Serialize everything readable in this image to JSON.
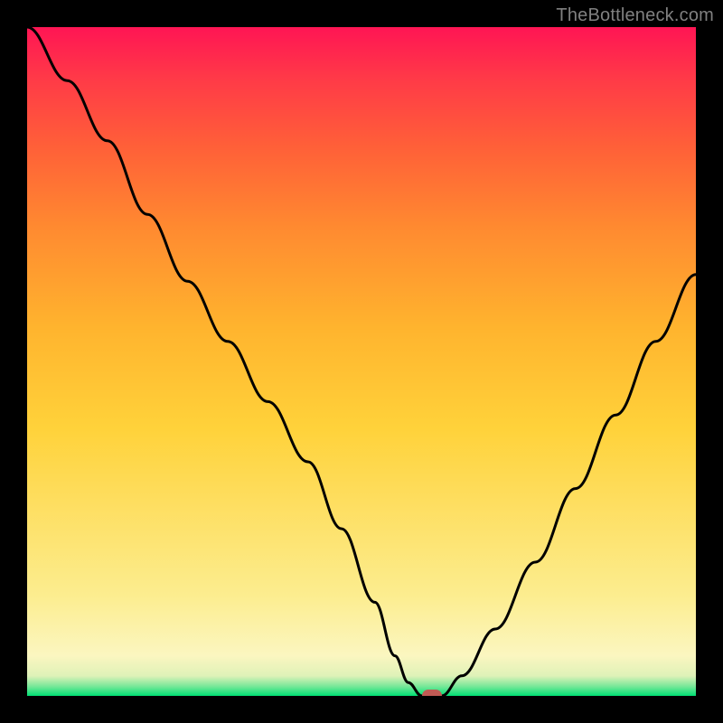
{
  "watermark": "TheBottleneck.com",
  "chart_data": {
    "type": "line",
    "title": "",
    "xlabel": "",
    "ylabel": "",
    "xlim": [
      0,
      100
    ],
    "ylim": [
      0,
      100
    ],
    "background_gradient_stops": [
      {
        "pos": 0.0,
        "color": "#00e074"
      },
      {
        "pos": 0.015,
        "color": "#7de89a"
      },
      {
        "pos": 0.03,
        "color": "#dff2b8"
      },
      {
        "pos": 0.06,
        "color": "#fbf6c0"
      },
      {
        "pos": 0.15,
        "color": "#fced8f"
      },
      {
        "pos": 0.4,
        "color": "#ffd23a"
      },
      {
        "pos": 0.55,
        "color": "#ffb42e"
      },
      {
        "pos": 0.7,
        "color": "#ff8a30"
      },
      {
        "pos": 0.82,
        "color": "#ff6038"
      },
      {
        "pos": 0.92,
        "color": "#ff3b47"
      },
      {
        "pos": 1.0,
        "color": "#ff1554"
      }
    ],
    "series": [
      {
        "name": "bottleneck-curve",
        "x": [
          0,
          6,
          12,
          18,
          24,
          30,
          36,
          42,
          47,
          52,
          55,
          57,
          59,
          62,
          65,
          70,
          76,
          82,
          88,
          94,
          100
        ],
        "y": [
          100,
          92,
          83,
          72,
          62,
          53,
          44,
          35,
          25,
          14,
          6,
          2,
          0,
          0,
          3,
          10,
          20,
          31,
          42,
          53,
          63
        ]
      }
    ],
    "marker": {
      "x": 60.5,
      "y": 0
    },
    "marker_color": "#c15a54"
  }
}
